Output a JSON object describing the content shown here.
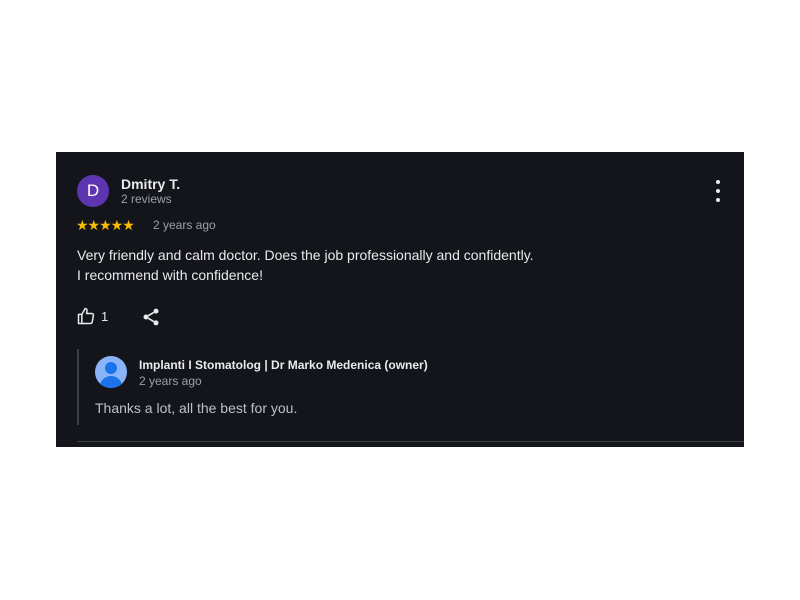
{
  "review": {
    "avatar_letter": "D",
    "avatar_color": "#5e35b1",
    "reviewer_name": "Dmitry T.",
    "reviewer_meta": "2 reviews",
    "rating": 5,
    "stars_text": "★★★★★",
    "date": "2 years ago",
    "text_lines": [
      "Very friendly and calm doctor. Does the job professionally and confidently.",
      "I recommend with confidence!"
    ],
    "like_count": "1",
    "more_icon": "more-vert-icon",
    "like_icon": "thumb-up-icon",
    "share_icon": "share-icon"
  },
  "reply": {
    "owner_name": "Implanti I Stomatolog | Dr Marko Medenica (owner)",
    "date": "2 years ago",
    "text": "Thanks a lot, all the best for you.",
    "avatar_icon": "person-icon"
  },
  "colors": {
    "card_background": "#14151b",
    "star": "#fbbc04",
    "owner_avatar": "#8ab4f8"
  }
}
